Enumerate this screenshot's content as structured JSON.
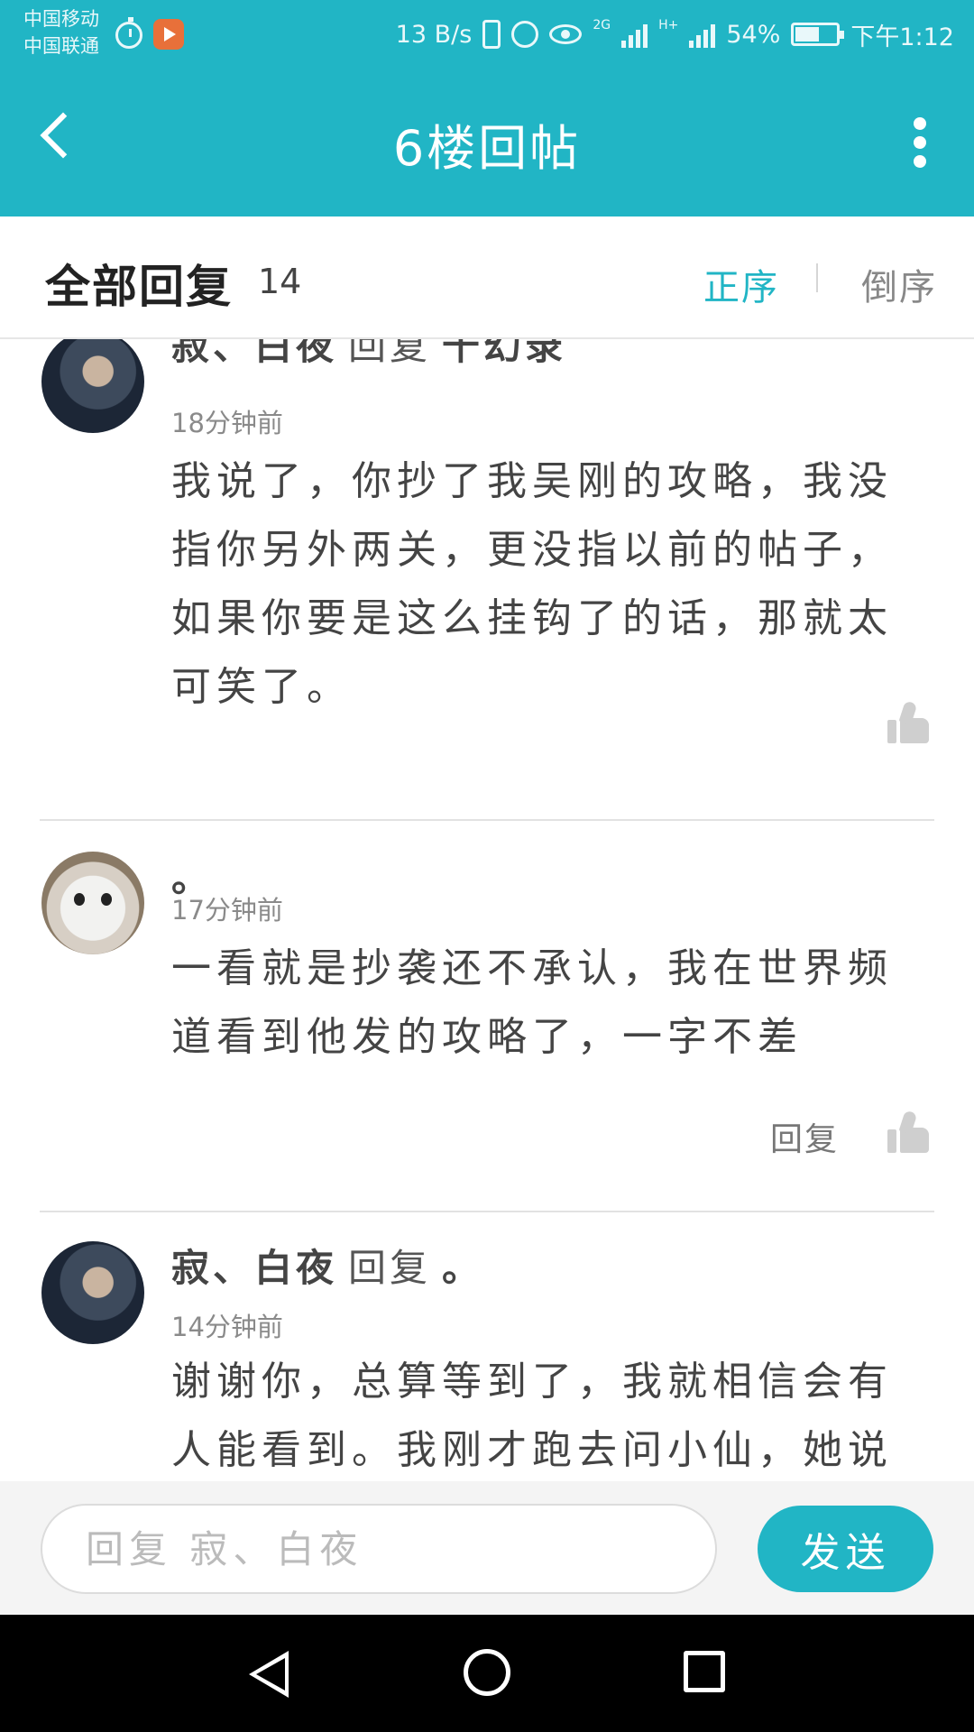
{
  "status_bar": {
    "carrier_1": "中国移动",
    "carrier_2": "中国联通",
    "net_speed": "13 B/s",
    "signal_1": "2G",
    "signal_2": "H+",
    "battery": "54%",
    "time": "下午1:12"
  },
  "header": {
    "title": "6楼回帖"
  },
  "replies_header": {
    "title": "全部回复",
    "count": "14",
    "sort_asc": "正序",
    "sort_desc": "倒序",
    "active_sort": "正序"
  },
  "replies": [
    {
      "name": "寂、白夜",
      "reply_word": "回复",
      "reply_to": "千幻录",
      "time": "18分钟前",
      "content": "我说了，你抄了我吴刚的攻略，我没指你另外两关，更没指以前的帖子，如果你要是这么挂钩了的话，那就太可笑了。"
    },
    {
      "name": "。",
      "time": "17分钟前",
      "content": "一看就是抄袭还不承认，我在世界频道看到他发的攻略了，一字不差",
      "reply_button": "回复"
    },
    {
      "name": "寂、白夜",
      "reply_word": "回复",
      "reply_to": "。",
      "time": "14分钟前",
      "content": "谢谢你，总算等到了，我就相信会有人能看到。我刚才跑去问小仙，她说服务"
    }
  ],
  "input_bar": {
    "placeholder": "回复 寂、白夜",
    "send_label": "发送"
  },
  "colors": {
    "accent": "#21b5c5",
    "nav_bar": "#000000"
  },
  "icons": [
    "back-arrow-icon",
    "more-vertical-icon",
    "thumbs-up-icon",
    "nav-back-icon",
    "nav-home-icon",
    "nav-recent-icon"
  ]
}
